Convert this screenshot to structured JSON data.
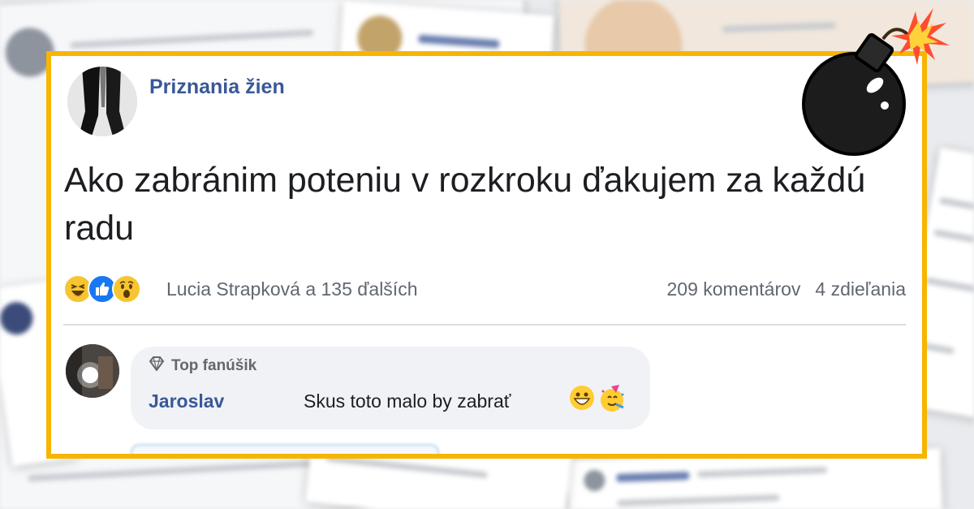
{
  "post": {
    "author": "Priznania žien",
    "text": "Ako zabránim poteniu v rozkroku ďakujem za každú radu",
    "reactions": [
      "haha-icon",
      "like-icon",
      "wow-icon"
    ],
    "reactors": "Lucia Strapková a 135 ďalších",
    "comments_count": "209 komentárov",
    "shares_count": "4 zdieľania"
  },
  "comment": {
    "badge": "Top fanúšik",
    "badge_icon": "diamond-icon",
    "author": "Jaroslav",
    "text": "Skus toto malo by zabrať",
    "emojis": [
      "grinning-face-icon",
      "party-face-icon"
    ]
  },
  "overlay": {
    "icon": "bomb-icon"
  },
  "colors": {
    "frame": "#f7b500",
    "link": "#385898",
    "muted": "#606770"
  }
}
